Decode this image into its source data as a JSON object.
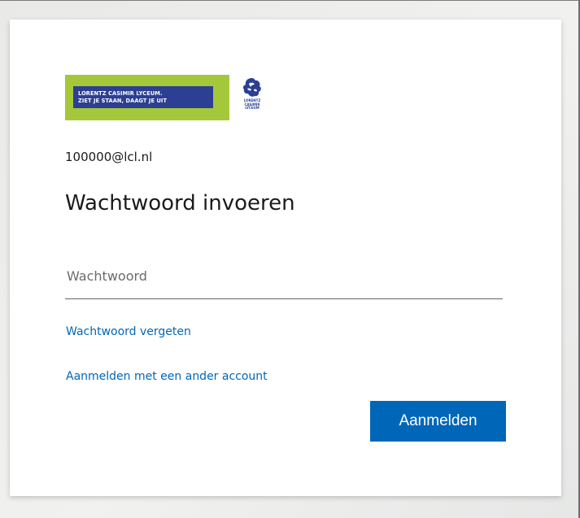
{
  "logo": {
    "banner_line1": "LORENTZ CASIMIR LYCEUM.",
    "banner_line2": "ZIET JE STAAN, DAAGT JE UIT",
    "emblem_lines": [
      "LORENTZ",
      "CASIMIR",
      "LYCEUM"
    ],
    "banner_green": "#a5c83a",
    "banner_blue": "#2c3f93"
  },
  "account": {
    "email": "100000@lcl.nl"
  },
  "title": "Wachtwoord invoeren",
  "password": {
    "placeholder": "Wachtwoord",
    "value": ""
  },
  "links": {
    "forgot_password": "Wachtwoord vergeten",
    "other_account": "Aanmelden met een ander account"
  },
  "button": {
    "sign_in": "Aanmelden"
  },
  "colors": {
    "accent": "#0067b8",
    "text": "#1b1b1b"
  }
}
